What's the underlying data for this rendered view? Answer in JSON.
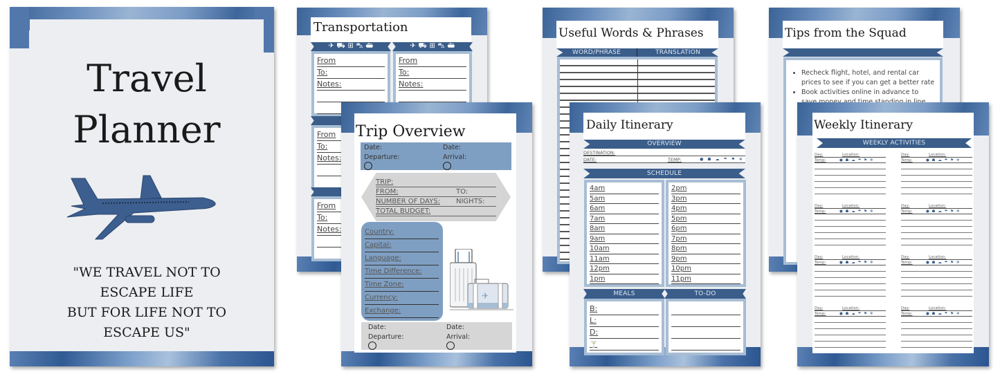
{
  "cover": {
    "title_line1": "Travel",
    "title_line2": "Planner",
    "icon": "airplane-icon",
    "quote_lines": [
      "\"WE TRAVEL NOT TO",
      "ESCAPE LIFE",
      "BUT FOR LIFE NOT TO",
      "ESCAPE US\""
    ]
  },
  "transportation": {
    "title": "Transportation",
    "icons": [
      "plane",
      "car",
      "train",
      "bus",
      "ship"
    ],
    "card_fields": [
      "From",
      "To:",
      "Notes:"
    ]
  },
  "trip_overview": {
    "title": "Trip Overview",
    "top_left": [
      "Date:",
      "Departure:"
    ],
    "top_right": [
      "Date:",
      "Arrival:"
    ],
    "hex_fields": {
      "trip": "TRIP:",
      "from": "FROM:",
      "to": "TO:",
      "days": "NUMBER OF DAYS:",
      "nights": "NIGHTS:",
      "budget": "TOTAL BUDGET:"
    },
    "country_fields": [
      "Country:",
      "Capital:",
      "Language:",
      "Time Difference:",
      "Time Zone:",
      "Currency:",
      "Exchange:"
    ],
    "bottom_left": [
      "Date:",
      "Departure:"
    ],
    "bottom_right": [
      "Date:",
      "Arrival:"
    ]
  },
  "useful_words": {
    "title": "Useful Words & Phrases",
    "col1": "WORD/PHRASE",
    "col2": "TRANSLATION"
  },
  "daily_itinerary": {
    "title": "Daily Itinerary",
    "overview_label": "OVERVIEW",
    "destination_label": "DESTINATION:",
    "date_label": "DATE:",
    "temp_label": "TEMP:",
    "schedule_label": "SCHEDULE",
    "am_times": [
      "4am",
      "5am",
      "6am",
      "7am",
      "8am",
      "9am",
      "10am",
      "11am",
      "12pm",
      "1pm"
    ],
    "pm_times": [
      "2pm",
      "3pm",
      "4pm",
      "5pm",
      "6pm",
      "7pm",
      "8pm",
      "9pm",
      "10pm",
      "11pm"
    ],
    "meals_label": "MEALS",
    "todo_label": "TO-DO",
    "meals": [
      "B:",
      "L:",
      "D:",
      "🍸"
    ]
  },
  "tips": {
    "title": "Tips from the Squad",
    "bullets": [
      "Recheck flight, hotel, and rental car prices to see if you can get a better rate",
      "Book activities online in advance to save money and time standing in line while"
    ]
  },
  "weekly_itinerary": {
    "title": "Weekly Itinerary",
    "section_label": "WEEKLY ACTIVITIES",
    "day_label": "Day:",
    "location_label": "Location:",
    "temp_label": "Temp:",
    "weather_icons": "● ☗ ☁ ☂ ⚑ ❄"
  },
  "colors": {
    "navy": "#3a5d8a",
    "light_blue": "#a7bdd4",
    "mid_blue": "#7f9fc2",
    "grey": "#d6d6d6"
  }
}
